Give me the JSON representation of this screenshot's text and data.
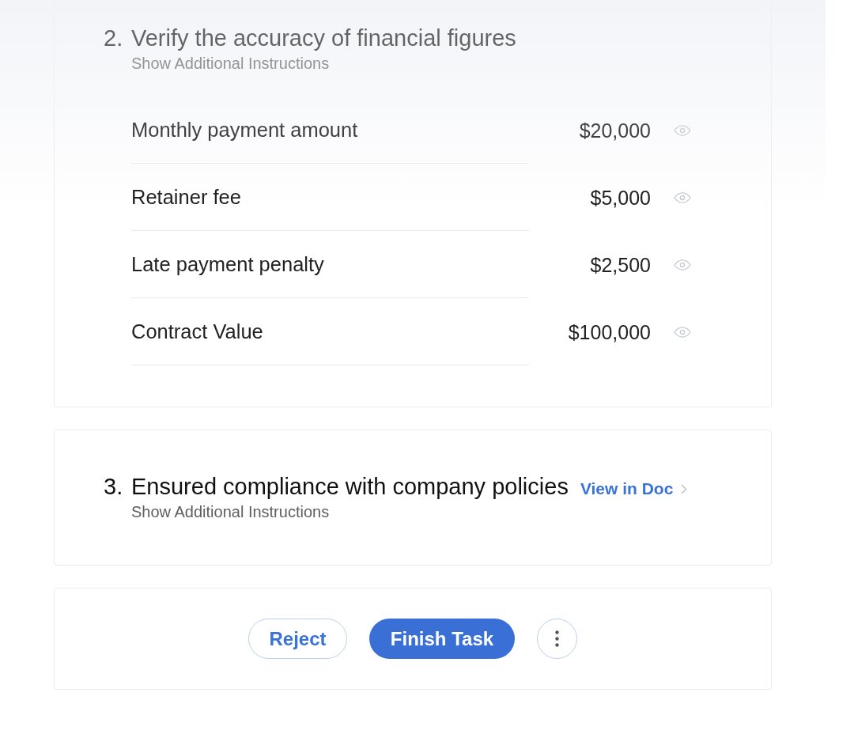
{
  "sections": [
    {
      "number": "2.",
      "title": "Verify the accuracy of financial figures",
      "subtitle": "Show Additional Instructions",
      "rows": [
        {
          "label": "Monthly payment amount",
          "value": "$20,000"
        },
        {
          "label": "Retainer fee",
          "value": "$5,000"
        },
        {
          "label": "Late payment penalty",
          "value": "$2,500"
        },
        {
          "label": "Contract Value",
          "value": "$100,000"
        }
      ]
    },
    {
      "number": "3.",
      "title": "Ensured compliance with company policies",
      "subtitle": "Show Additional Instructions",
      "link": "View in Doc"
    }
  ],
  "actions": [
    {
      "kind": "outline",
      "label": "Reject"
    },
    {
      "kind": "primary",
      "label": "Finish Task"
    },
    {
      "kind": "more"
    }
  ]
}
